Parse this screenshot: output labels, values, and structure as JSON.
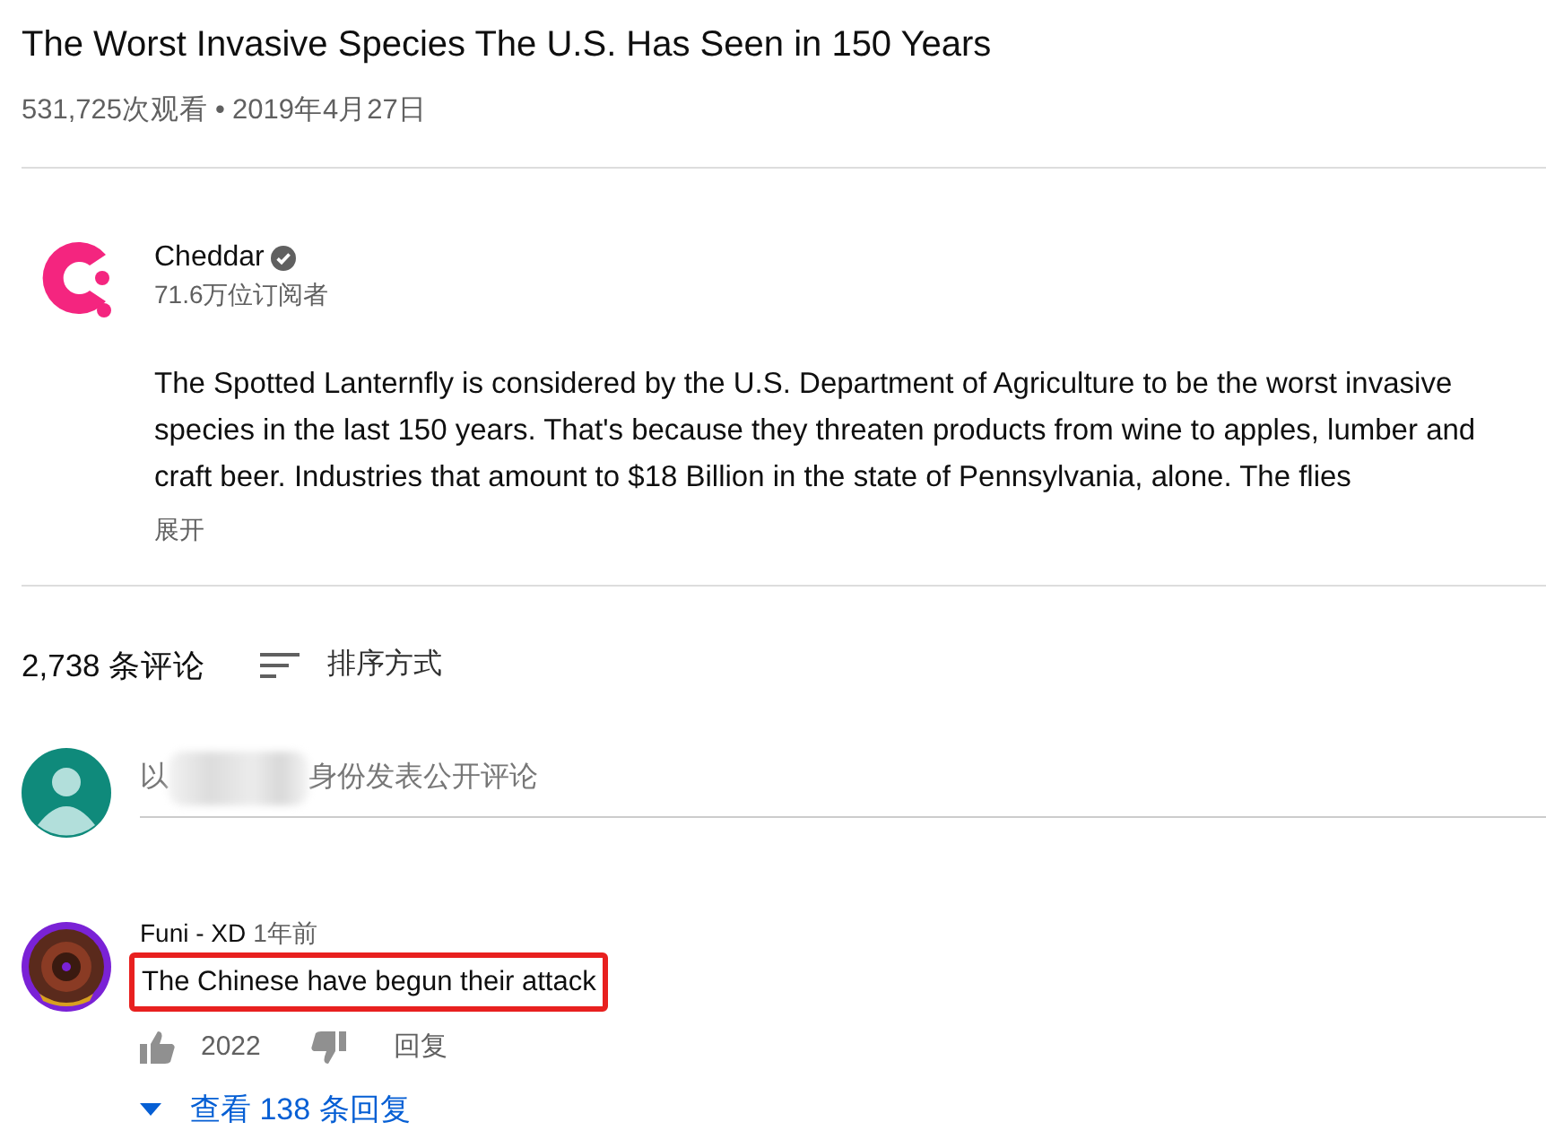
{
  "video": {
    "title": "The Worst Invasive Species The U.S. Has Seen in 150 Years",
    "views": "531,725次观看",
    "separator": "•",
    "date": "2019年4月27日"
  },
  "channel": {
    "name": "Cheddar",
    "verified": true,
    "subscribers": "71.6万位订阅者"
  },
  "description": {
    "text": "The Spotted Lanternfly is considered by the U.S. Department of Agriculture to be the worst invasive species in the last 150 years. That's because they threaten products from wine to apples, lumber and craft beer. Industries that amount to $18 Billion in the state of Pennsylvania, alone. The flies",
    "expand": "展开"
  },
  "comments_header": {
    "count": "2,738 条评论",
    "sort": "排序方式"
  },
  "comment_box": {
    "prefix": "以",
    "suffix": "身份发表公开评论"
  },
  "comments": [
    {
      "author": "Funi - XD",
      "time": "1年前",
      "text": "The Chinese have begun their attack",
      "highlighted": true,
      "likes": "2022",
      "reply": "回复",
      "view_replies": "查看 138 条回复"
    }
  ]
}
